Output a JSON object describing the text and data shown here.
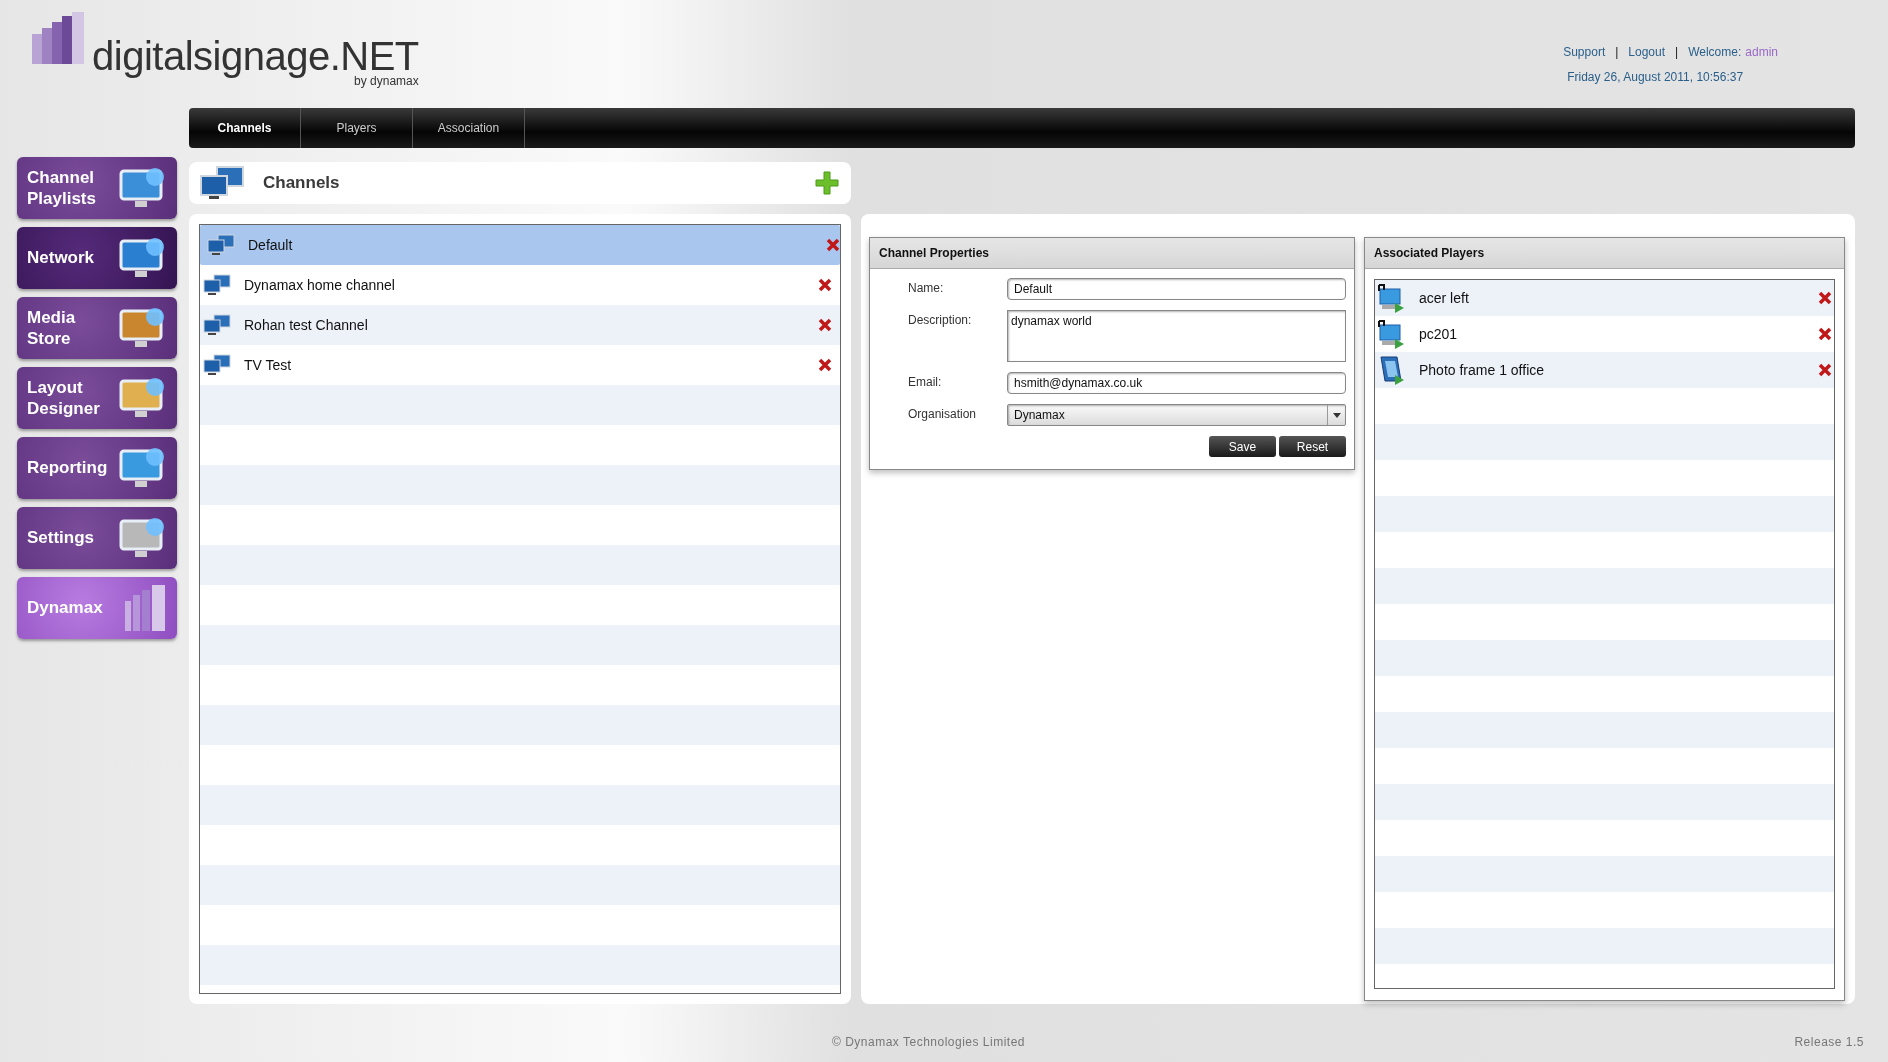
{
  "header": {
    "logo_text": "digitalsignage.NET",
    "logo_subtext": "by dynamax",
    "links": [
      {
        "kind": "link",
        "text": "Support"
      },
      {
        "kind": "separator",
        "text": "|"
      },
      {
        "kind": "link",
        "text": "Logout"
      },
      {
        "kind": "separator",
        "text": "|"
      }
    ],
    "welcome_label": "Welcome:",
    "user": "admin",
    "datetime": "Friday 26, August 2011, 10:56:37"
  },
  "tabs": [
    {
      "label": "Channels",
      "selected": true
    },
    {
      "label": "Players",
      "selected": false
    },
    {
      "label": "Association",
      "selected": false
    }
  ],
  "sidebar": {
    "items": [
      {
        "label": "Channel Playlists",
        "kind": "module",
        "selected": false
      },
      {
        "label": "Network",
        "kind": "module",
        "selected": true
      },
      {
        "label": "Media Store",
        "kind": "module",
        "selected": false
      },
      {
        "label": "Layout Designer",
        "kind": "module",
        "selected": false
      },
      {
        "label": "Reporting",
        "kind": "module",
        "selected": false
      },
      {
        "label": "Settings",
        "kind": "module",
        "selected": false
      },
      {
        "label": "Dynamax",
        "kind": "brand",
        "selected": false
      }
    ]
  },
  "channels": {
    "title": "Channels",
    "rows": [
      {
        "name": "Default",
        "selected": true
      },
      {
        "name": "Dynamax home channel",
        "selected": false
      },
      {
        "name": "Rohan test Channel",
        "selected": false
      },
      {
        "name": "TV Test",
        "selected": false
      }
    ]
  },
  "channel_properties": {
    "title": "Channel Properties",
    "fields": [
      {
        "label": "Name:",
        "kind": "text",
        "value": "Default"
      },
      {
        "label": "Description:",
        "kind": "textarea",
        "value": "dynamax world"
      },
      {
        "label": "Email:",
        "kind": "text",
        "value": "hsmith@dynamax.co.uk"
      },
      {
        "label": "Organisation",
        "kind": "select",
        "value": "Dynamax"
      }
    ],
    "buttons": [
      "Save",
      "Reset"
    ]
  },
  "associated_players": {
    "title": "Associated Players",
    "rows": [
      {
        "name": "acer left",
        "kind": "computer"
      },
      {
        "name": "pc201",
        "kind": "computer"
      },
      {
        "name": "Photo frame 1 office",
        "kind": "photo-frame"
      }
    ]
  },
  "footer": {
    "copyright": "© Dynamax Technologies Limited",
    "release": "Release 1.5"
  }
}
